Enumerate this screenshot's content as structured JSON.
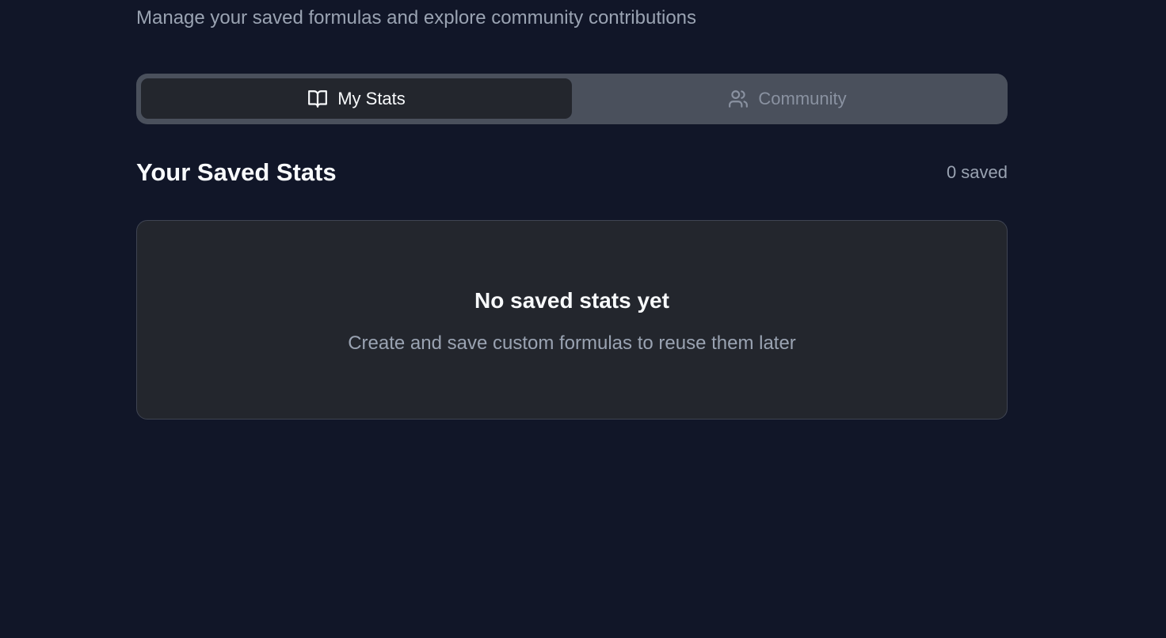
{
  "header": {
    "subtitle": "Manage your saved formulas and explore community contributions"
  },
  "tabs": [
    {
      "label": "My Stats",
      "icon": "book-open-icon",
      "active": true
    },
    {
      "label": "Community",
      "icon": "users-icon",
      "active": false
    }
  ],
  "section": {
    "title": "Your Saved Stats",
    "count_text": "0 saved"
  },
  "empty_state": {
    "title": "No saved stats yet",
    "description": "Create and save custom formulas to reuse them later"
  },
  "colors": {
    "background": "#111628",
    "tab_bar": "#4a505c",
    "active_tab": "#23262d",
    "card": "#23262d",
    "muted_text": "#9aa3b2"
  }
}
